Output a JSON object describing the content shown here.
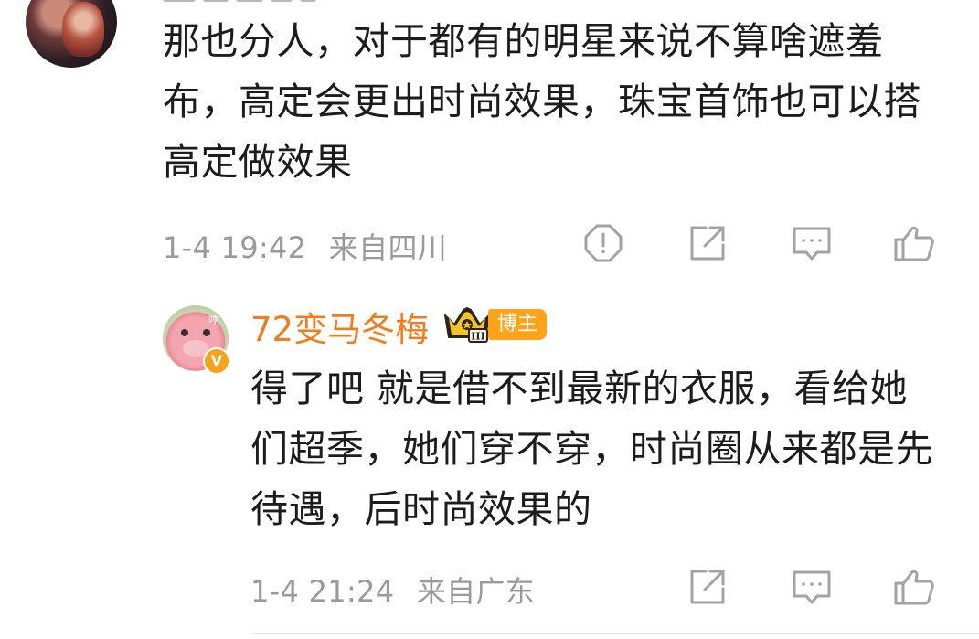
{
  "parent_comment": {
    "text": "那也分人，对于都有的明星来说不算啥遮羞布，高定会更出时尚效果，珠宝首饰也可以搭高定做效果",
    "time": "1-4 19:42",
    "location": "来自四川",
    "icons": [
      "report-icon",
      "share-icon",
      "comment-icon",
      "like-icon"
    ]
  },
  "reply_comment": {
    "author": "72变马冬梅",
    "author_badge": "博主",
    "avatar_overlay": "哼",
    "verified_mark": "V",
    "crown_level": "III",
    "text": "得了吧 就是借不到最新的衣服，看给她们超季，她们穿不穿，时尚圈从来都是先待遇，后时尚效果的",
    "time": "1-4 21:24",
    "location": "来自广东",
    "icons": [
      "share-icon",
      "comment-icon",
      "like-icon"
    ]
  },
  "colors": {
    "author_name": "#f27c1a",
    "badge_bg": "#ffa31a",
    "meta_text": "#9a9a9a",
    "icon_stroke": "#a3a3a3"
  }
}
